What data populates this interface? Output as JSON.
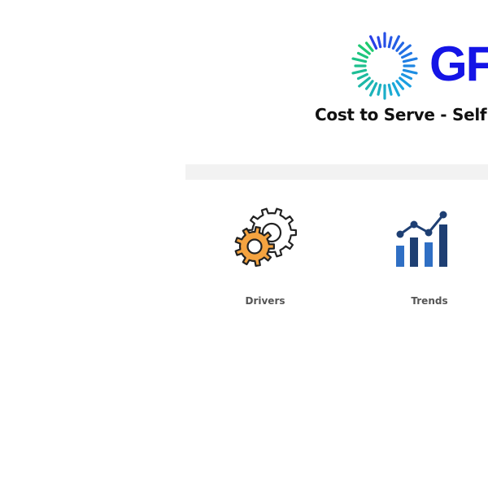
{
  "header": {
    "logo_text": "GF",
    "title": "Cost to Serve -  Self S",
    "logo_icon": "sunburst-logo-icon"
  },
  "nav": {
    "tiles": [
      {
        "label": "Drivers",
        "icon": "gears-icon",
        "accent_color": "#f4a340"
      },
      {
        "label": "Trends",
        "icon": "bar-line-chart-icon",
        "accent_color": "#2f6fc4"
      }
    ]
  },
  "colors": {
    "brand_blue": "#1414e6",
    "logo_gradient": [
      "#1ecb6b",
      "#1aa7e0",
      "#2a39e8"
    ],
    "nav_bar_background": "#f2f2f2"
  }
}
